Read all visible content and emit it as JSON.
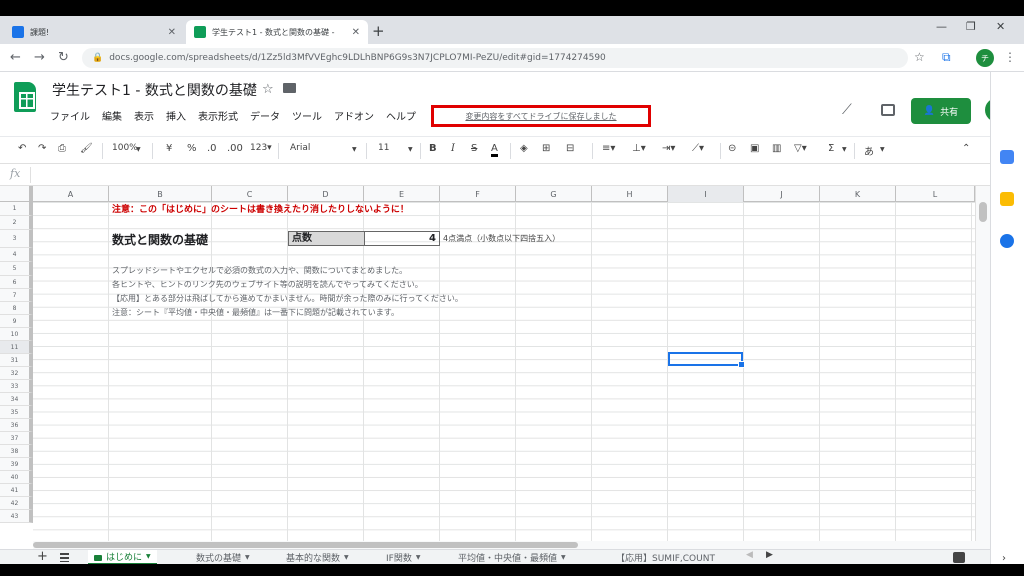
{
  "browser": {
    "tabs": [
      {
        "title": "課題!",
        "active": false
      },
      {
        "title": "学生テスト1 - 数式と関数の基礎 -",
        "active": true
      }
    ],
    "url": "docs.google.com/spreadsheets/d/1Zz5ld3MfVVEghc9LDLhBNP6G9s3N7JCPLO7MI-PeZU/edit#gid=1774274590",
    "profile_initial": "チ"
  },
  "sheets": {
    "title": "学生テスト1 - 数式と関数の基礎",
    "menu": [
      "ファイル",
      "編集",
      "表示",
      "挿入",
      "表示形式",
      "データ",
      "ツール",
      "アドオン",
      "ヘルプ"
    ],
    "save_status": "変更内容をすべてドライブに保存しました",
    "share_label": "共有",
    "user_initial": "チ",
    "toolbar": {
      "zoom": "100%",
      "currency": "¥",
      "percent": "%",
      "dec_less": ".0",
      "dec_more": ".00",
      "format": "123▾",
      "font": "Arial",
      "font_size": "11",
      "bold": "B",
      "italic": "I",
      "strike": "S",
      "text_color": "A",
      "sigma": "Σ",
      "input_tool": "あ"
    },
    "fx": "fx"
  },
  "grid": {
    "columns": [
      "A",
      "B",
      "C",
      "D",
      "E",
      "F",
      "G",
      "H",
      "I",
      "J",
      "K",
      "L"
    ],
    "rows": [
      "1",
      "2",
      "3",
      "4",
      "5",
      "6",
      "7",
      "8",
      "9",
      "10",
      "11",
      "31",
      "32",
      "33",
      "34",
      "35",
      "36",
      "37",
      "38",
      "39",
      "40",
      "41",
      "42",
      "43"
    ],
    "warning": "注意：この「はじめに」のシートは書き換えたり消したりしないように！",
    "heading": "数式と関数の基礎",
    "score_label": "点数",
    "score_value": "4",
    "score_note": "4点満点（小数点以下四捨五入）",
    "descriptions": [
      "スプレッドシートやエクセルで必須の数式の入力や、関数についてまとめました。",
      "各ヒントや、ヒントのリンク先のウェブサイト等の説明を読んでやってみてください。",
      "【応用】とある部分は飛ばしてから進めてかまいません。時間が余った際のみに行ってください。",
      "注意：シート『平均値・中央値・最頻値』は一番下に問題が記載されています。"
    ]
  },
  "sheet_tabs": [
    "はじめに",
    "数式の基礎",
    "基本的な関数",
    "IF関数",
    "平均値・中央値・最頻値",
    "【応用】SUMIF,COUNT"
  ],
  "colors": {
    "sheets_green": "#0f9d58",
    "share_green": "#1e8e3e",
    "highlight_red": "#e00000",
    "warning_red": "#cc0000",
    "selection_blue": "#1a73e8"
  }
}
